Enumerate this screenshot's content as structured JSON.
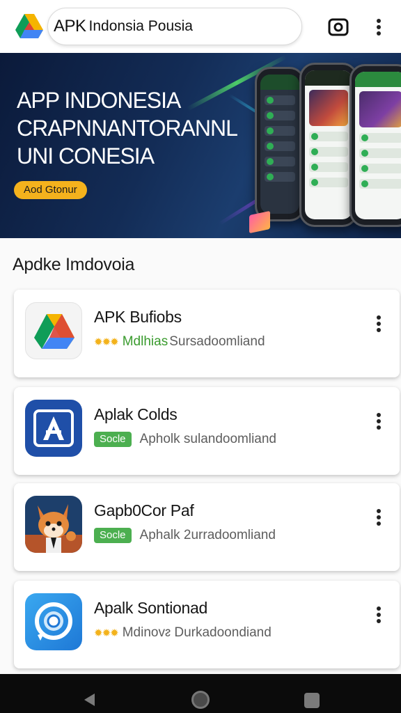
{
  "topbar": {
    "logo_icon": "drive-logo-icon",
    "search_brand": "APK",
    "search_text": "Indonsia Pousia",
    "camera_icon": "camera-icon",
    "more_icon": "more-vert-icon"
  },
  "banner": {
    "title_lines": [
      "APP INDONESIA",
      "CRAPNNANTORANNL",
      "UNI CONESIA"
    ],
    "cta_label": "Aod Gtonur"
  },
  "section": {
    "title": "Apdke Imdovoia"
  },
  "apps": [
    {
      "name": "APK Bufiobs",
      "meta_type": "stars",
      "stars": "✹✹✹",
      "highlight": "Mdlhias",
      "subtitle": "Sursadoomliand",
      "icon": "drive-triangle-icon"
    },
    {
      "name": "Aplak Colds",
      "meta_type": "badge",
      "badge": "Socle",
      "subtitle": "Apholk sulandoomliand",
      "icon": "blue-a-app-icon"
    },
    {
      "name": "Gapb0Cor Paf",
      "meta_type": "badge",
      "badge": "Socle",
      "subtitle": "Aphalk 2urradoomliand",
      "icon": "fox-character-icon"
    },
    {
      "name": "Apalk Sontionad",
      "meta_type": "stars",
      "stars": "✹✹✹",
      "highlight": "",
      "subtitle": "Mdinovᴤ Durkadoondiand",
      "icon": "blue-lens-app-icon"
    }
  ],
  "navbar": {
    "back_icon": "back-triangle-icon",
    "home_icon": "home-circle-icon",
    "recent_icon": "recent-square-icon"
  },
  "colors": {
    "accent_green": "#4caf50",
    "star_yellow": "#f3b21b",
    "cta_yellow": "#f4b21d",
    "banner_bg": "#132c56"
  }
}
